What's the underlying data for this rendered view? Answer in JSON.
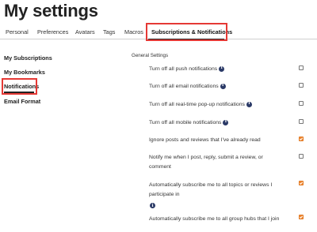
{
  "page": {
    "title": "My settings"
  },
  "tabs": [
    {
      "label": "Personal"
    },
    {
      "label": "Preferences"
    },
    {
      "label": "Avatars"
    },
    {
      "label": "Tags"
    },
    {
      "label": "Macros"
    },
    {
      "label": "Subscriptions & Notifications",
      "active": true
    }
  ],
  "sidebar": {
    "items": [
      {
        "label": "My Subscriptions"
      },
      {
        "label": "My Bookmarks"
      },
      {
        "label": "Notifications",
        "active": true
      },
      {
        "label": "Email Format"
      }
    ]
  },
  "general": {
    "section_label": "General Settings",
    "options": [
      {
        "label": "Turn off all push notifications",
        "info_icon": true,
        "checked": false
      },
      {
        "label": "Turn off all email notifications",
        "info_icon": true,
        "checked": false
      },
      {
        "label": "Turn off all real-time pop-up notifications",
        "info_icon": true,
        "checked": false
      },
      {
        "label": "Turn off all mobile notifications",
        "info_icon": true,
        "checked": false
      },
      {
        "label": "Ignore posts and reviews that I've already read",
        "info_icon": false,
        "checked": true
      },
      {
        "label": "Notify me when I post, reply, submit a review, or comment",
        "info_icon": false,
        "checked": false
      },
      {
        "label": "Automatically subscribe me to all topics or reviews I participate in",
        "info_icon": true,
        "checked": true
      },
      {
        "label": "Automatically subscribe me to all group hubs that I join",
        "info_icon": false,
        "checked": true
      }
    ],
    "info_glyph": "i"
  },
  "colors": {
    "highlight": "#e53935",
    "checkbox_checked": "#f08a35",
    "info_icon": "#2b3a67"
  }
}
